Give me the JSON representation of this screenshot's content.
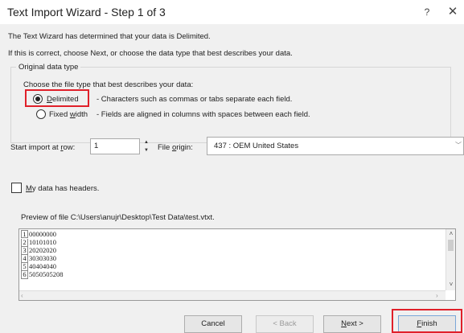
{
  "window": {
    "title": "Text Import Wizard - Step 1 of 3",
    "help_glyph": "?",
    "close_glyph": "✕"
  },
  "description": {
    "line1": "The Text Wizard has determined that your data is Delimited.",
    "line2": "If this is correct, choose Next, or choose the data type that best describes your data."
  },
  "original_data_type": {
    "legend": "Original data type",
    "prompt": "Choose the file type that best describes your data:",
    "options": [
      {
        "mnemonic": "D",
        "rest": "elimited",
        "description": "- Characters such as commas or tabs separate each field.",
        "selected": true
      },
      {
        "lead": "Fixed ",
        "mnemonic": "w",
        "rest": "idth",
        "description": "- Fields are aligned in columns with spaces between each field.",
        "selected": false
      }
    ]
  },
  "start_import": {
    "label_lead": "Start import at ",
    "mnemonic": "r",
    "label_rest": "ow:",
    "value": "1"
  },
  "file_origin": {
    "label_lead": "File ",
    "mnemonic": "o",
    "label_rest": "rigin:",
    "value": "437 : OEM United States"
  },
  "headers_checkbox": {
    "mnemonic": "M",
    "label_rest": "y data has headers.",
    "checked": false
  },
  "preview": {
    "label": "Preview of file C:\\Users\\anujr\\Desktop\\Test Data\\test.vtxt.",
    "rows": [
      {
        "num": "1",
        "value": "00000000"
      },
      {
        "num": "2",
        "value": "10101010"
      },
      {
        "num": "3",
        "value": "20202020"
      },
      {
        "num": "4",
        "value": "30303030"
      },
      {
        "num": "5",
        "value": "40404040"
      },
      {
        "num": "6",
        "value": "5050505208"
      }
    ]
  },
  "buttons": {
    "cancel": "Cancel",
    "back": "< Back",
    "next_mnemonic": "N",
    "next_rest": "ext >",
    "finish_mnemonic": "F",
    "finish_rest": "inish"
  },
  "colors": {
    "highlight_box": "#e0202a",
    "dialog_bg": "#f0f0f0"
  }
}
